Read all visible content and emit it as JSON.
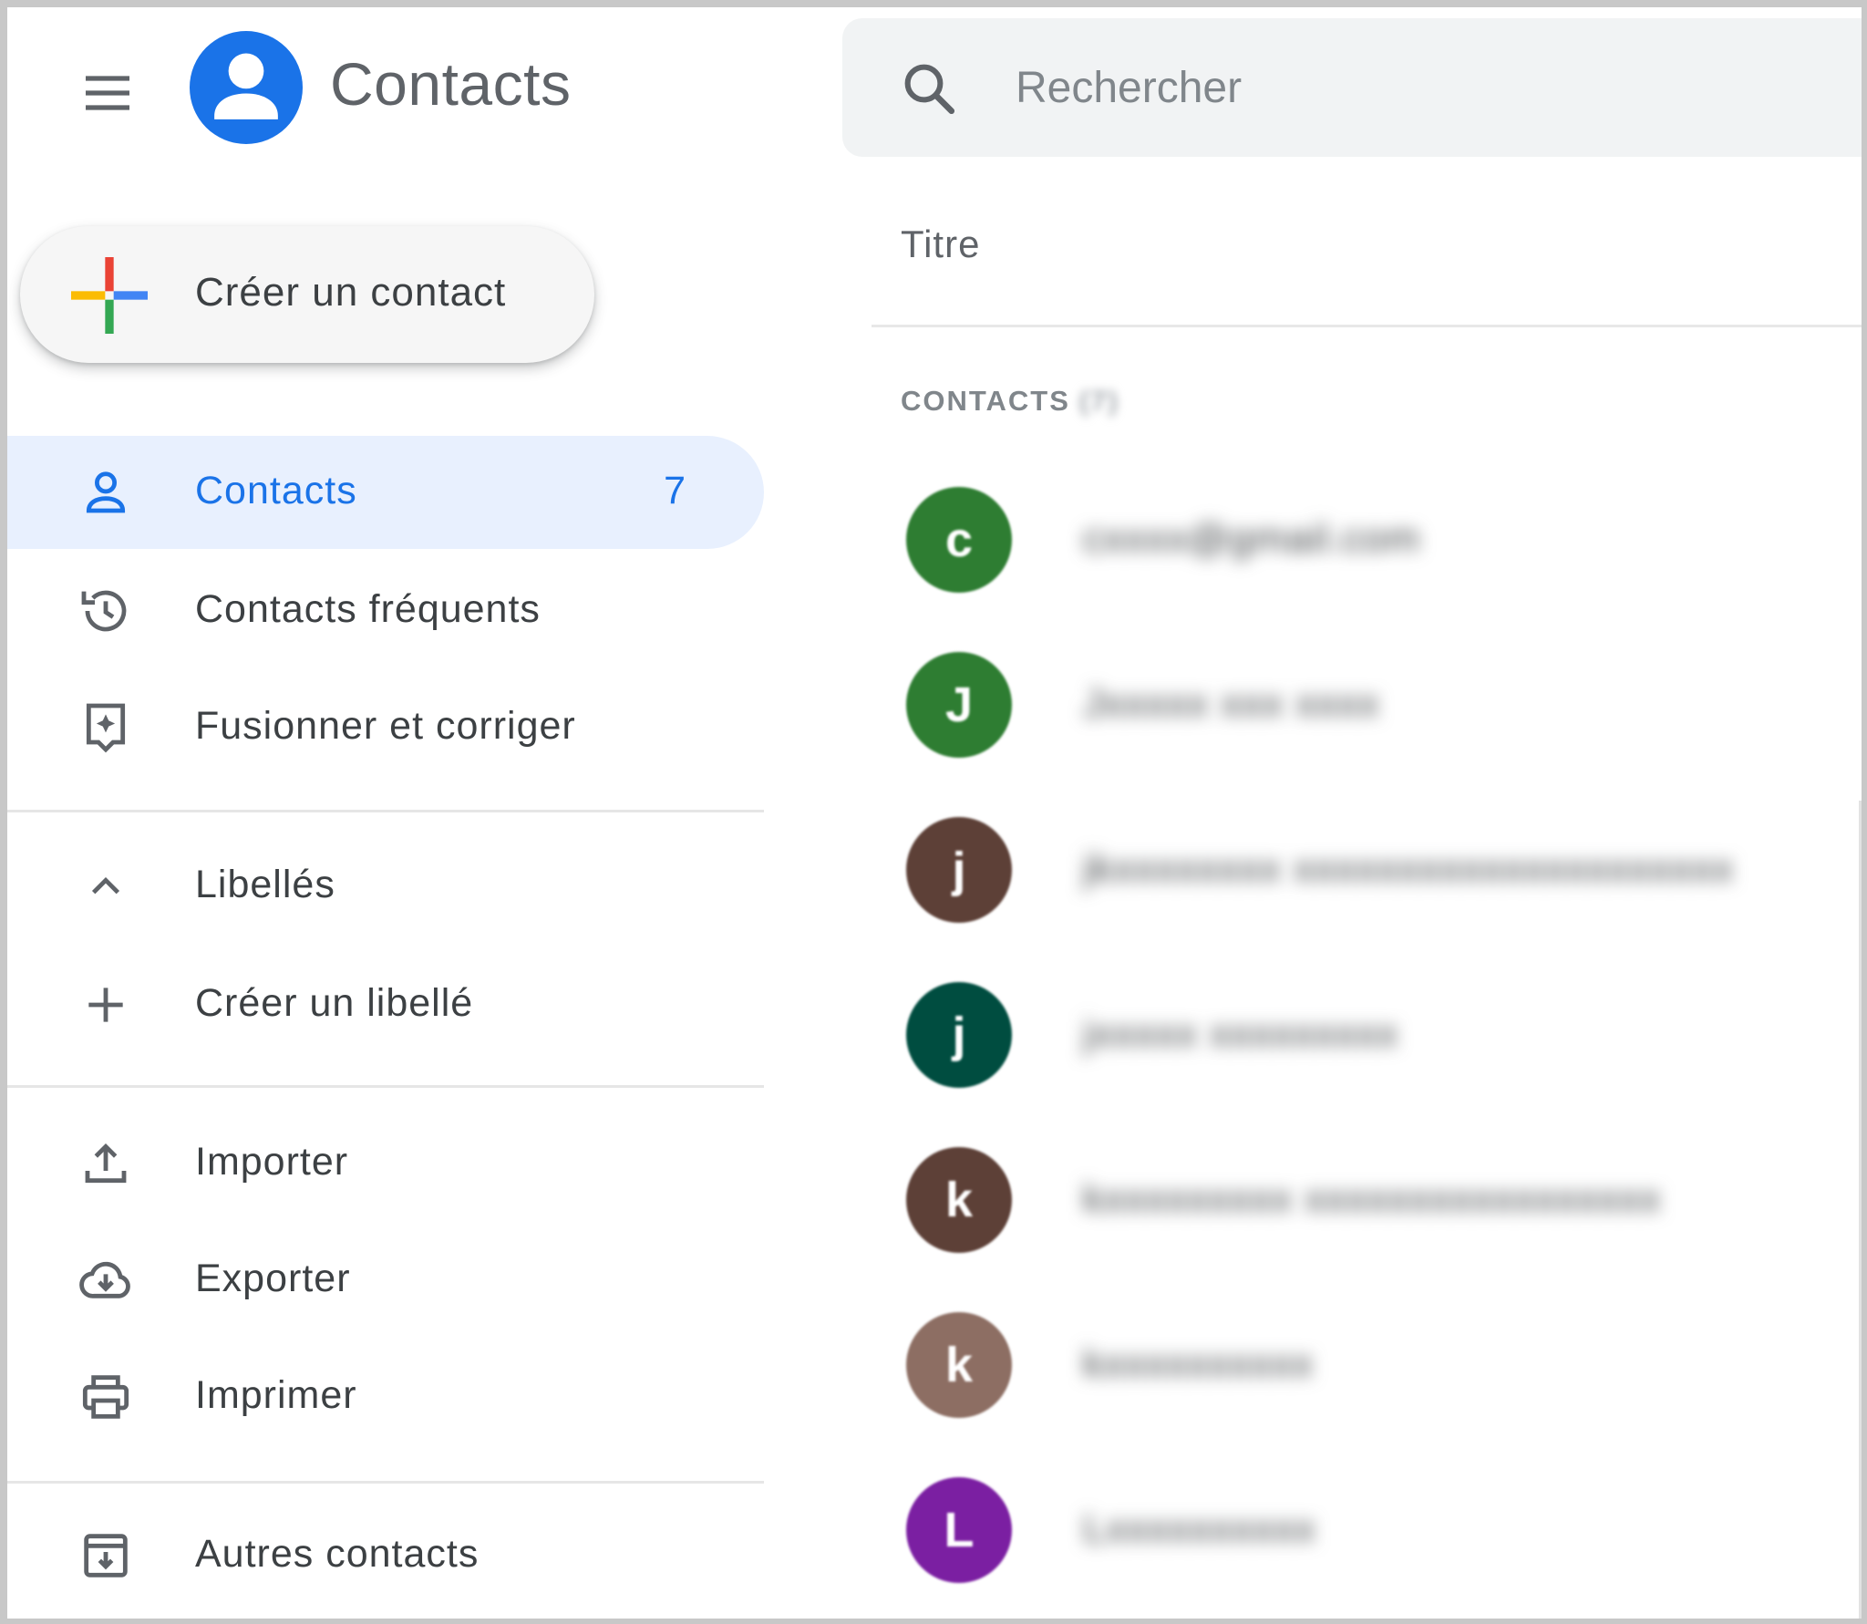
{
  "header": {
    "app_title": "Contacts",
    "menu_icon": "hamburger-menu-icon",
    "logo_icon": "contacts-logo-icon",
    "logo_color": "#1a73e8"
  },
  "search": {
    "placeholder": "Rechercher",
    "value": "",
    "icon": "search-icon"
  },
  "sidebar": {
    "create_button_label": "Créer un contact",
    "items": [
      {
        "label": "Contacts",
        "count": "7",
        "icon": "person-icon",
        "active": true
      },
      {
        "label": "Contacts fréquents",
        "icon": "history-icon"
      },
      {
        "label": "Fusionner et corriger",
        "icon": "merge-fix-icon"
      },
      {
        "label": "Libellés",
        "icon": "chevron-up-icon"
      },
      {
        "label": "Créer un libellé",
        "icon": "plus-icon"
      },
      {
        "label": "Importer",
        "icon": "upload-icon"
      },
      {
        "label": "Exporter",
        "icon": "cloud-download-icon"
      },
      {
        "label": "Imprimer",
        "icon": "printer-icon"
      },
      {
        "label": "Autres contacts",
        "icon": "archive-icon"
      }
    ],
    "active_color": "#1a73e8",
    "active_bg": "#e8f0fe"
  },
  "main": {
    "column_header": "Titre",
    "section_title": "CONTACTS",
    "section_count": "(7)",
    "contacts": [
      {
        "initial": "c",
        "name": "cxxxx@gmail.com",
        "color": "#2e7d32"
      },
      {
        "initial": "J",
        "name": "Jxxxxx xxx xxxx",
        "color": "#2e7d32"
      },
      {
        "initial": "j",
        "name": "jkxxxxxxxx xxxxxxxxxxxxxxxxxxxxx",
        "color": "#5d4037"
      },
      {
        "initial": "j",
        "name": "jxxxxx xxxxxxxxx",
        "color": "#004d40"
      },
      {
        "initial": "k",
        "name": "kxxxxxxxxx xxxxxxxxxxxxxxxxx",
        "color": "#5d4037"
      },
      {
        "initial": "k",
        "name": "kxxxxxxxxxx",
        "color": "#8d6e63"
      },
      {
        "initial": "L",
        "name": "Lxxxxxxxxxx",
        "color": "#7b1fa2"
      }
    ]
  }
}
